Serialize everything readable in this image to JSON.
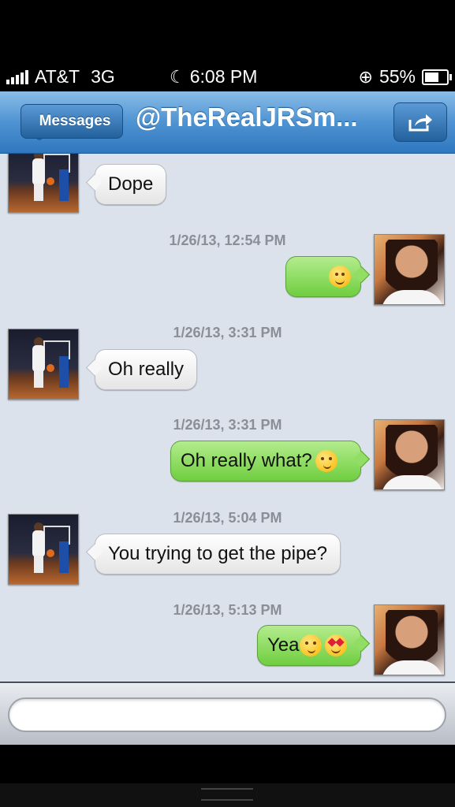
{
  "status": {
    "carrier": "AT&T",
    "network": "3G",
    "time": "6:08 PM",
    "battery": "55%"
  },
  "nav": {
    "back_label": "Messages",
    "title": "@TheRealJRSm...",
    "share_icon": "share-icon"
  },
  "messages": [
    {
      "direction": "incoming",
      "text": "Dope",
      "timestamp": ""
    },
    {
      "direction": "outgoing",
      "text": "",
      "emoji": [
        "smile"
      ],
      "timestamp": "1/26/13, 12:54 PM"
    },
    {
      "direction": "incoming",
      "text": "Oh really",
      "timestamp": "1/26/13, 3:31 PM"
    },
    {
      "direction": "outgoing",
      "text": "Oh really what?",
      "emoji": [
        "smirk"
      ],
      "timestamp": "1/26/13, 3:31 PM"
    },
    {
      "direction": "incoming",
      "text": "You trying to get the pipe?",
      "timestamp": "1/26/13, 5:04 PM"
    },
    {
      "direction": "outgoing",
      "text": "Yea",
      "emoji": [
        "smirk",
        "heart-eyes"
      ],
      "timestamp": "1/26/13, 5:13 PM"
    }
  ],
  "colors": {
    "nav_blue": "#4e93d2",
    "incoming_bubble": "#f5f5f5",
    "outgoing_bubble": "#8fdc5f",
    "background": "#dbe2ec"
  }
}
